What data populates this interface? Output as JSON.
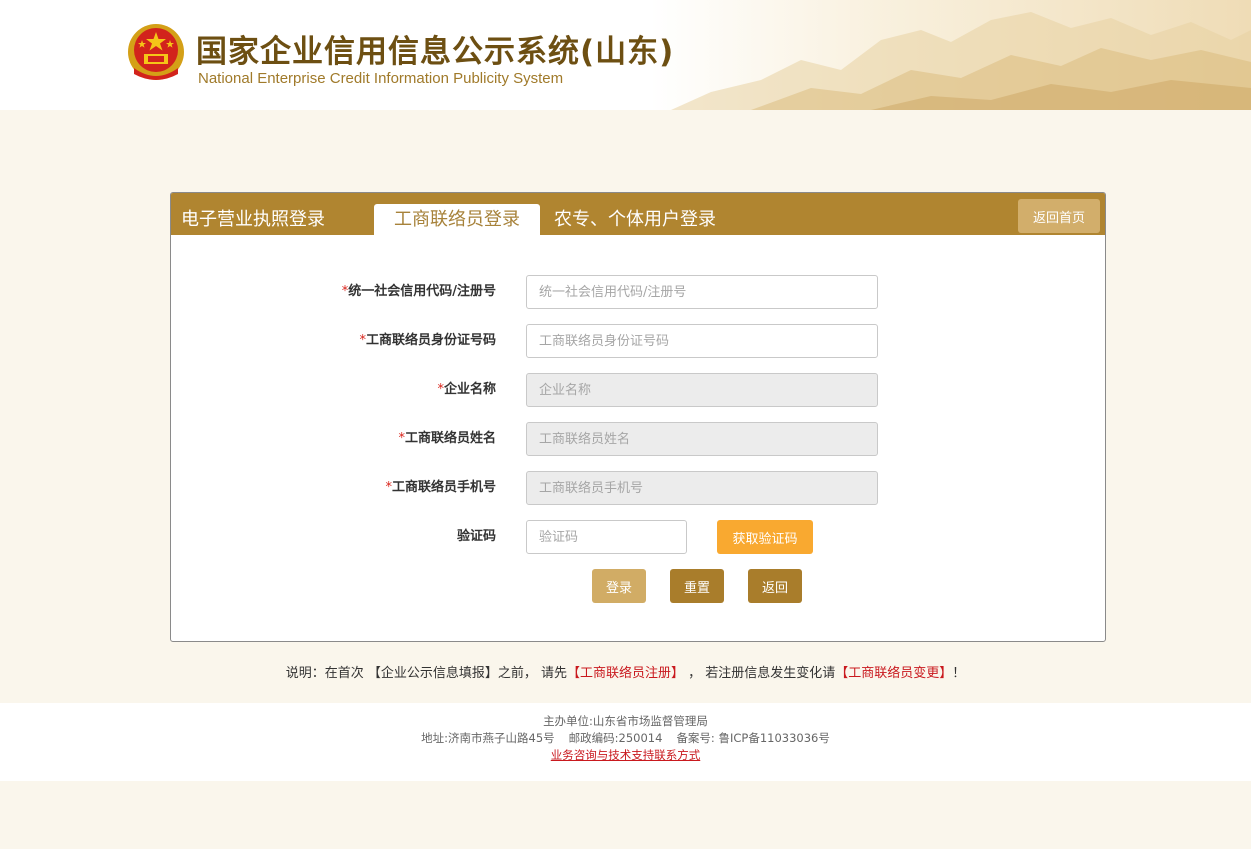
{
  "header": {
    "title": "国家企业信用信息公示系统(山东)",
    "subtitle": "National Enterprise Credit Information Publicity System"
  },
  "tabs": [
    {
      "label": "电子营业执照登录"
    },
    {
      "label": "工商联络员登录"
    },
    {
      "label": "农专、个体用户登录"
    }
  ],
  "home_button": "返回首页",
  "form": {
    "required_mark": "*",
    "fields": [
      {
        "label": "统一社会信用代码/注册号",
        "placeholder": "统一社会信用代码/注册号"
      },
      {
        "label": "工商联络员身份证号码",
        "placeholder": "工商联络员身份证号码"
      },
      {
        "label": "企业名称",
        "placeholder": "企业名称"
      },
      {
        "label": "工商联络员姓名",
        "placeholder": "工商联络员姓名"
      },
      {
        "label": "工商联络员手机号",
        "placeholder": "工商联络员手机号"
      }
    ],
    "captcha": {
      "label": "验证码",
      "placeholder": "验证码",
      "button": "获取验证码"
    },
    "buttons": {
      "login": "登录",
      "reset": "重置",
      "back": "返回"
    }
  },
  "note": {
    "prefix": "说明：在首次 【企业公示信息填报】之前， 请先",
    "link1": "【工商联络员注册】",
    "middle": " ， 若注册信息发生变化请",
    "link2": "【工商联络员变更】",
    "suffix": "！"
  },
  "footer": {
    "sponsor": "主办单位:山东省市场监督管理局",
    "address": "地址:济南市燕子山路45号",
    "postcode": "邮政编码:250014",
    "icp": "备案号: 鲁ICP备11033036号",
    "support_link": "业务咨询与技术支持联系方式"
  },
  "colors": {
    "brand": "#b08530",
    "accent_orange": "#f9a930",
    "link_red": "#c9191e",
    "page_bg": "#faf6ec"
  }
}
